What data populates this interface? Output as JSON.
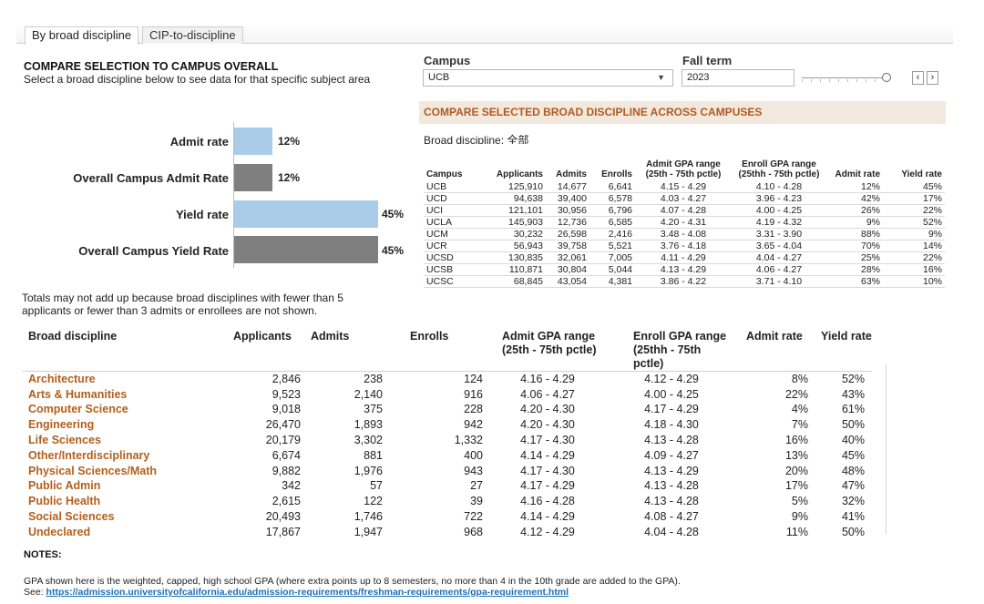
{
  "tabs": [
    {
      "label": "By broad discipline",
      "active": true
    },
    {
      "label": "CIP-to-discipline",
      "active": false
    }
  ],
  "compare": {
    "title": "COMPARE SELECTION TO CAMPUS OVERALL",
    "subtitle": "Select a broad discipline below to see data for that specific subject area"
  },
  "filters": {
    "campus_label": "Campus",
    "campus_value": "UCB",
    "term_label": "Fall term",
    "term_value": "2023",
    "term_slider_position": 1.0
  },
  "banner": "COMPARE SELECTED BROAD DISCIPLINE ACROSS CAMPUSES",
  "broad_discipline_label": "Broad discipline: 全部",
  "colors": {
    "accent": "#b35f1a",
    "bar_selected": "#a9cde9",
    "bar_overall": "#7f7f7f",
    "banner_bg": "#f3e8dd"
  },
  "chart_data": {
    "type": "bar",
    "orientation": "horizontal",
    "categories": [
      "Admit rate",
      "Overall Campus Admit Rate",
      "Yield rate",
      "Overall Campus Yield Rate"
    ],
    "values": [
      12,
      12,
      45,
      45
    ],
    "value_labels": [
      "12%",
      "12%",
      "45%",
      "45%"
    ],
    "unit": "%",
    "xlim": [
      0,
      45
    ]
  },
  "campus_table": {
    "headers": [
      "Campus",
      "Applicants",
      "Admits",
      "Enrolls",
      "Admit GPA range\n(25th - 75th pctle)",
      "Enroll GPA range\n(25thh - 75th pctle)",
      "Admit rate",
      "Yield rate"
    ],
    "rows": [
      [
        "UCB",
        "125,910",
        "14,677",
        "6,641",
        "4.15 - 4.29",
        "4.10 - 4.28",
        "12%",
        "45%"
      ],
      [
        "UCD",
        "94,638",
        "39,400",
        "6,578",
        "4.03 - 4.27",
        "3.96 - 4.23",
        "42%",
        "17%"
      ],
      [
        "UCI",
        "121,101",
        "30,956",
        "6,796",
        "4.07 - 4.28",
        "4.00 - 4.25",
        "26%",
        "22%"
      ],
      [
        "UCLA",
        "145,903",
        "12,736",
        "6,585",
        "4.20 - 4.31",
        "4.19 - 4.32",
        "9%",
        "52%"
      ],
      [
        "UCM",
        "30,232",
        "26,598",
        "2,416",
        "3.48 - 4.08",
        "3.31 - 3.90",
        "88%",
        "9%"
      ],
      [
        "UCR",
        "56,943",
        "39,758",
        "5,521",
        "3.76 - 4.18",
        "3.65 - 4.04",
        "70%",
        "14%"
      ],
      [
        "UCSD",
        "130,835",
        "32,061",
        "7,005",
        "4.11 - 4.29",
        "4.04 - 4.27",
        "25%",
        "22%"
      ],
      [
        "UCSB",
        "110,871",
        "30,804",
        "5,044",
        "4.13 - 4.29",
        "4.06 - 4.27",
        "28%",
        "16%"
      ],
      [
        "UCSC",
        "68,845",
        "43,054",
        "4,381",
        "3.86 - 4.22",
        "3.71 - 4.10",
        "63%",
        "10%"
      ]
    ]
  },
  "totals_note": "Totals may not add up because broad disciplines with fewer than 5 applicants or fewer than 3 admits or enrollees are not shown.",
  "discipline_table": {
    "headers": [
      "Broad discipline",
      "Applicants",
      "Admits",
      "Enrolls",
      "Admit GPA range\n(25th - 75th pctle)",
      "Enroll GPA range\n(25thh - 75th pctle)",
      "Admit rate",
      "Yield rate"
    ],
    "rows": [
      [
        "Architecture",
        "2,846",
        "238",
        "124",
        "4.16 - 4.29",
        "4.12 - 4.29",
        "8%",
        "52%"
      ],
      [
        "Arts & Humanities",
        "9,523",
        "2,140",
        "916",
        "4.06 - 4.27",
        "4.00 - 4.25",
        "22%",
        "43%"
      ],
      [
        "Computer Science",
        "9,018",
        "375",
        "228",
        "4.20 - 4.30",
        "4.17 - 4.29",
        "4%",
        "61%"
      ],
      [
        "Engineering",
        "26,470",
        "1,893",
        "942",
        "4.20 - 4.30",
        "4.18 - 4.30",
        "7%",
        "50%"
      ],
      [
        "Life Sciences",
        "20,179",
        "3,302",
        "1,332",
        "4.17 - 4.30",
        "4.13 - 4.28",
        "16%",
        "40%"
      ],
      [
        "Other/Interdisciplinary",
        "6,674",
        "881",
        "400",
        "4.14 - 4.29",
        "4.09 - 4.27",
        "13%",
        "45%"
      ],
      [
        "Physical Sciences/Math",
        "9,882",
        "1,976",
        "943",
        "4.17 - 4.30",
        "4.13 - 4.29",
        "20%",
        "48%"
      ],
      [
        "Public Admin",
        "342",
        "57",
        "27",
        "4.17 - 4.29",
        "4.13 - 4.28",
        "17%",
        "47%"
      ],
      [
        "Public Health",
        "2,615",
        "122",
        "39",
        "4.16 - 4.28",
        "4.13 - 4.28",
        "5%",
        "32%"
      ],
      [
        "Social Sciences",
        "20,493",
        "1,746",
        "722",
        "4.14 - 4.29",
        "4.08 - 4.27",
        "9%",
        "41%"
      ],
      [
        "Undeclared",
        "17,867",
        "1,947",
        "968",
        "4.12 - 4.29",
        "4.04 - 4.28",
        "11%",
        "50%"
      ]
    ]
  },
  "notes": {
    "heading": "NOTES:",
    "gpa_text": "GPA shown here is the weighted, capped, high school GPA (where extra points up to 8 semesters, no more than 4 in the 10th grade are added to the GPA).",
    "see_label": "See: ",
    "link_text": "https://admission.universityofcalifornia.edu/admission-requirements/freshman-requirements/gpa-requirement.html"
  }
}
